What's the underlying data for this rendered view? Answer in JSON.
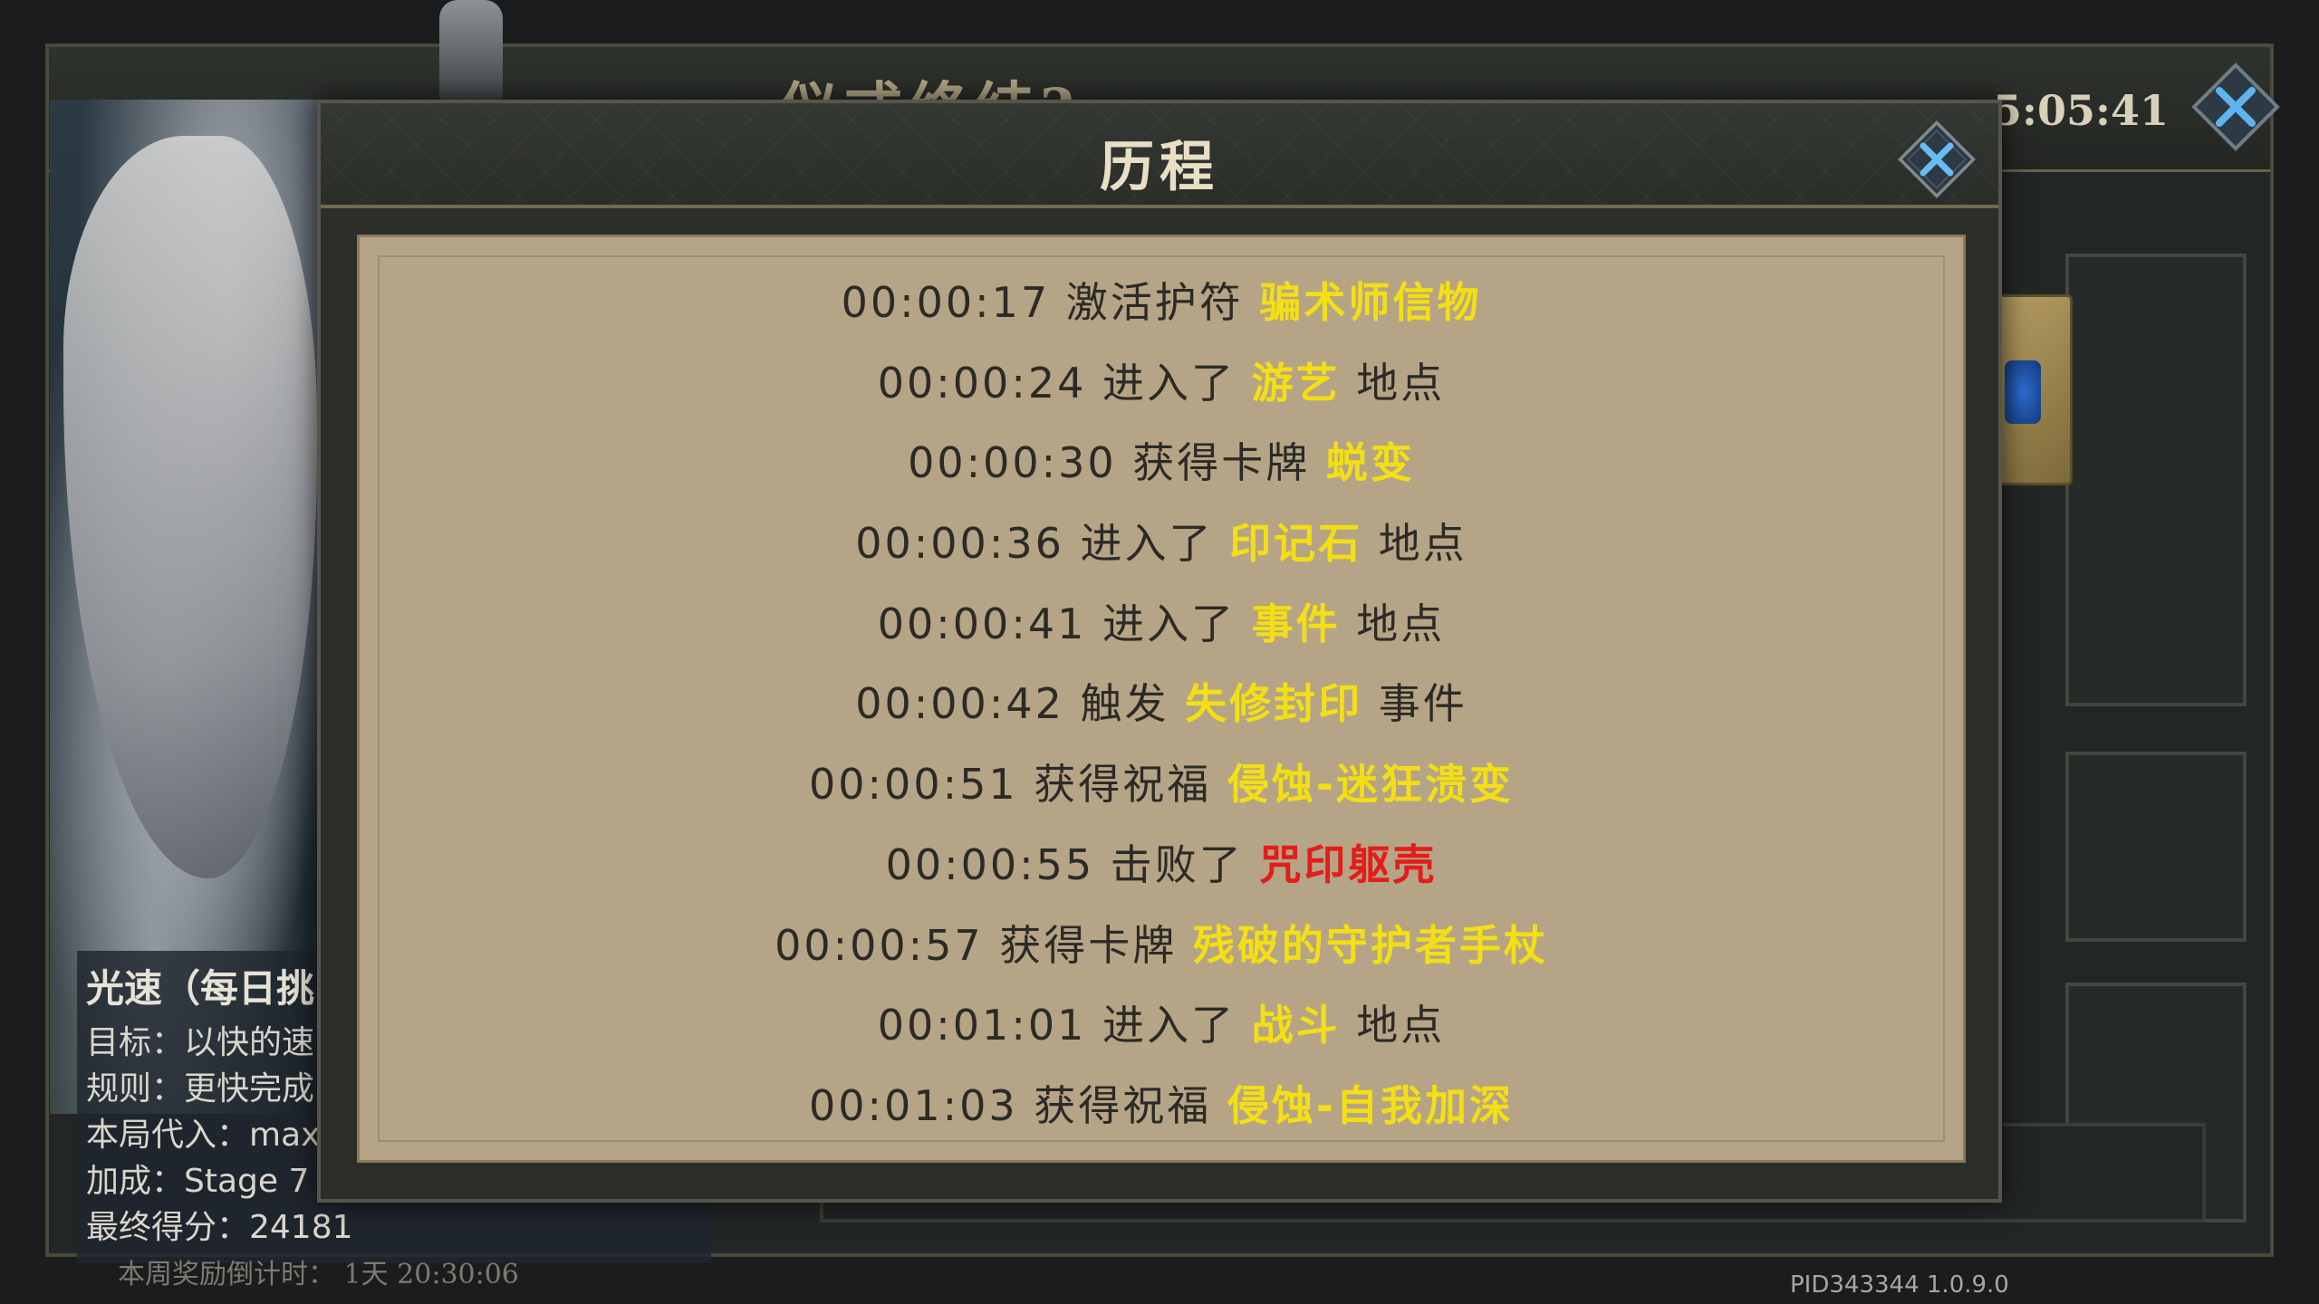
{
  "colors": {
    "highlight": "#f3df14",
    "enemy": "#e31d1a",
    "parchment": "#b6a486",
    "text": "#2b2a26"
  },
  "background": {
    "title_partial": "仪式终结?",
    "timer": "5:05:41",
    "close_icon": "close-x-icon"
  },
  "info_panel": {
    "title": "光速（每日挑",
    "lines": [
      "目标：以快的速",
      "规则：更快完成",
      "本局代入：max",
      "加成：Stage 7",
      "最终得分：24181"
    ],
    "reset": "本周奖励倒计时：     1天 20:30:06"
  },
  "version": "PID343344 1.0.9.0",
  "modal": {
    "title": "历程",
    "close_icon": "close-x-icon",
    "entries": [
      {
        "time": "00:00:17",
        "prefix": "激活护符",
        "name": "骗术师信物",
        "suffix": "",
        "color": "highlight"
      },
      {
        "time": "00:00:24",
        "prefix": "进入了",
        "name": "游艺",
        "suffix": "地点",
        "color": "highlight"
      },
      {
        "time": "00:00:30",
        "prefix": "获得卡牌",
        "name": "蜕变",
        "suffix": "",
        "color": "highlight"
      },
      {
        "time": "00:00:36",
        "prefix": "进入了",
        "name": "印记石",
        "suffix": "地点",
        "color": "highlight"
      },
      {
        "time": "00:00:41",
        "prefix": "进入了",
        "name": "事件",
        "suffix": "地点",
        "color": "highlight"
      },
      {
        "time": "00:00:42",
        "prefix": "触发",
        "name": "失修封印",
        "suffix": "事件",
        "color": "highlight"
      },
      {
        "time": "00:00:51",
        "prefix": "获得祝福",
        "name": "侵蚀-迷狂溃变",
        "suffix": "",
        "color": "highlight"
      },
      {
        "time": "00:00:55",
        "prefix": "击败了",
        "name": "咒印躯壳",
        "suffix": "",
        "color": "enemy"
      },
      {
        "time": "00:00:57",
        "prefix": "获得卡牌",
        "name": "残破的守护者手杖",
        "suffix": "",
        "color": "highlight"
      },
      {
        "time": "00:01:01",
        "prefix": "进入了",
        "name": "战斗",
        "suffix": "地点",
        "color": "highlight"
      },
      {
        "time": "00:01:03",
        "prefix": "获得祝福",
        "name": "侵蚀-自我加深",
        "suffix": "",
        "color": "highlight"
      }
    ]
  }
}
